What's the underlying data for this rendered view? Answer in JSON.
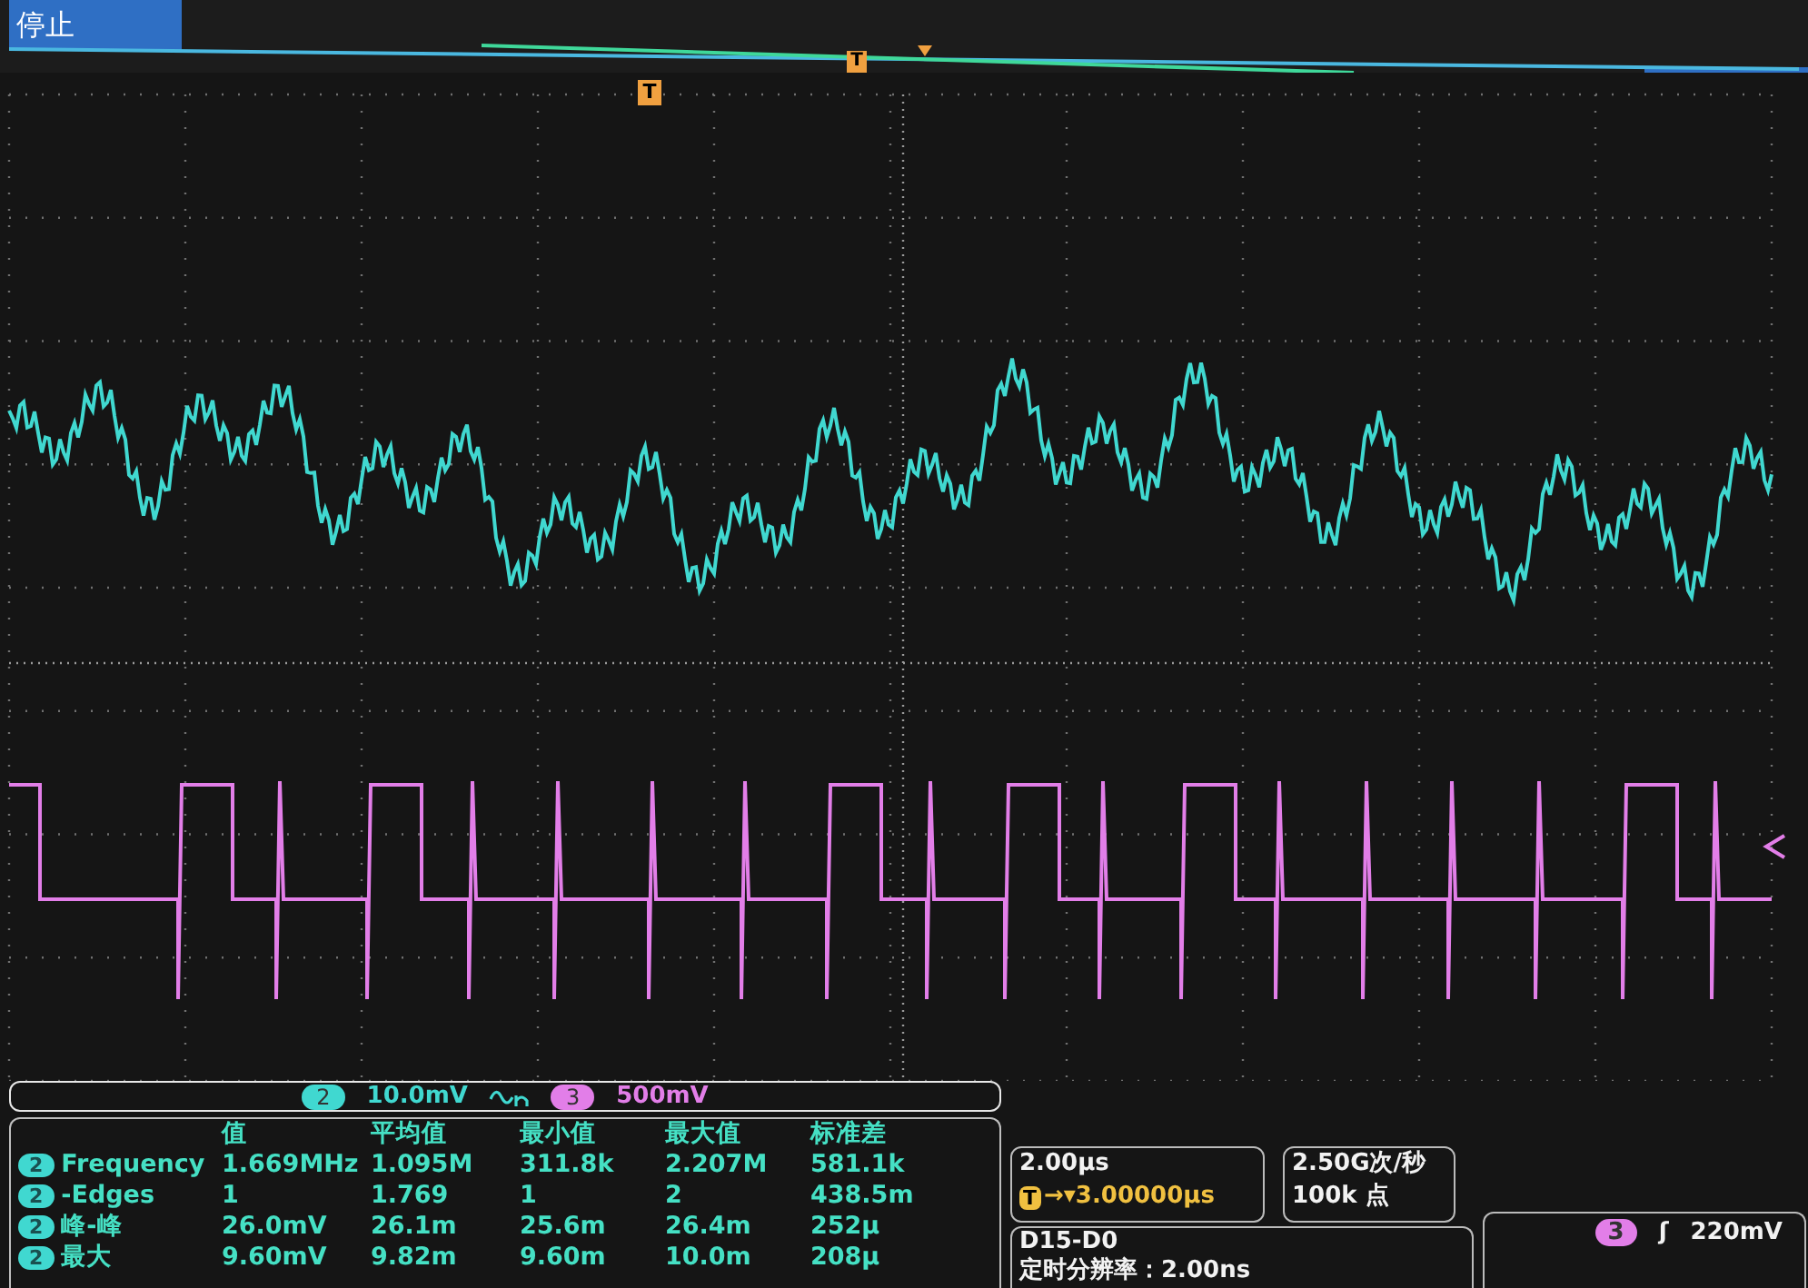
{
  "status": "停止",
  "trigger_markers": [
    "T",
    "T"
  ],
  "channel_bar": [
    {
      "channel": "2",
      "scale": "10.0mV",
      "color": "#40d8d0"
    },
    {
      "channel": "3",
      "scale": "500mV",
      "color": "#e27ee8"
    }
  ],
  "measurements": {
    "columns": [
      "值",
      "平均值",
      "最小值",
      "最大值",
      "标准差"
    ],
    "rows": [
      {
        "channel": "2",
        "name": "Frequency",
        "values": [
          "1.669MHz",
          "1.095M",
          "311.8k",
          "2.207M",
          "581.1k"
        ]
      },
      {
        "channel": "2",
        "name": "-Edges",
        "values": [
          "1",
          "1.769",
          "1",
          "2",
          "438.5m"
        ]
      },
      {
        "channel": "2",
        "name": "峰-峰",
        "values": [
          "26.0mV",
          "26.1m",
          "25.6m",
          "26.4m",
          "252µ"
        ]
      },
      {
        "channel": "2",
        "name": "最大",
        "values": [
          "9.60mV",
          "9.82m",
          "9.60m",
          "10.0m",
          "208µ"
        ]
      }
    ]
  },
  "timebase": {
    "scale": "2.00µs",
    "trigger_badge": "T",
    "trigger_position": "→▾3.00000µs"
  },
  "acquisition": {
    "sample_rate": "2.50G次/秒",
    "record_length": "100k 点"
  },
  "digital": {
    "title": "D15-D0",
    "resolution": "定时分辨率：2.00ns"
  },
  "trigger": {
    "channel": "3",
    "slope": "ʃ",
    "threshold": "220mV"
  }
}
